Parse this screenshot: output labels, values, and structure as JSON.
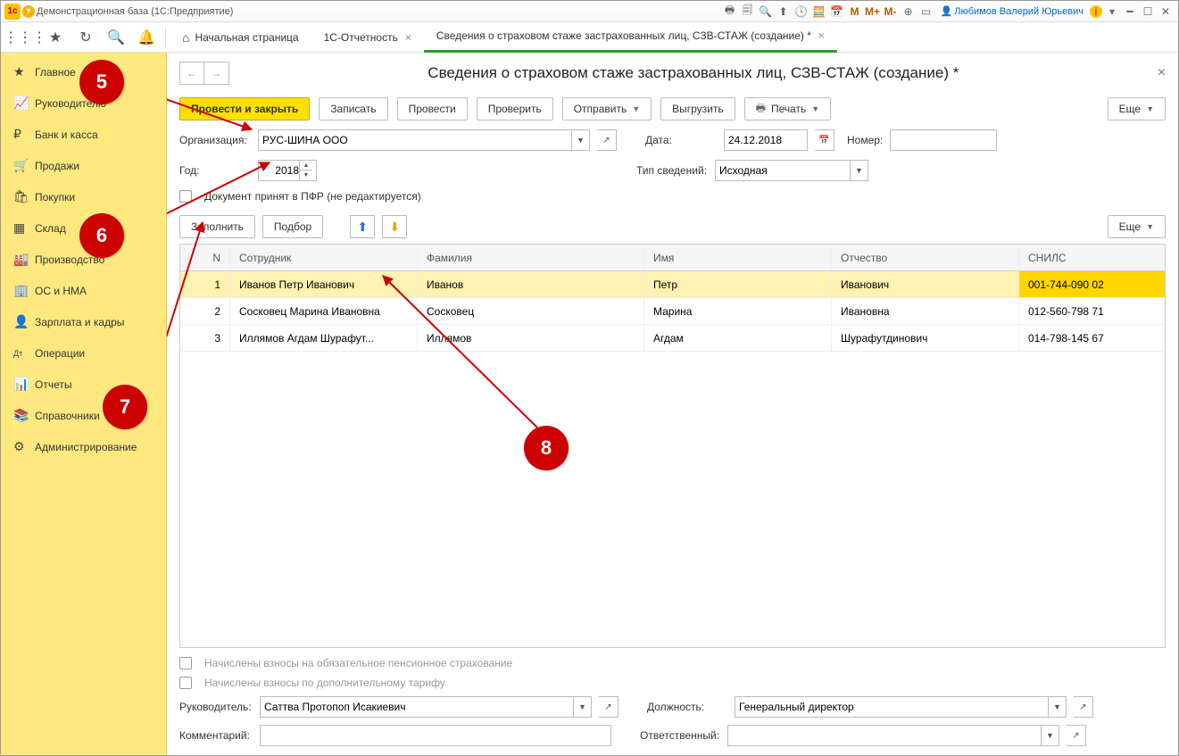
{
  "title": "Демонстрационная база  (1С:Предприятие)",
  "user": "Любимов Валерий Юрьевич",
  "toolbar_letters": {
    "m": "M",
    "mp": "M+",
    "mm": "M-"
  },
  "tabs": {
    "home": "Начальная страница",
    "t2": "1С-Отчетность",
    "t3": "Сведения о страховом стаже застрахованных лиц, СЗВ-СТАЖ (создание) *"
  },
  "sidebar": [
    {
      "icon": "★",
      "label": "Главное"
    },
    {
      "icon": "📈",
      "label": "Руководителю"
    },
    {
      "icon": "₽",
      "label": "Банк и касса"
    },
    {
      "icon": "🛒",
      "label": "Продажи"
    },
    {
      "icon": "🛍",
      "label": "Покупки"
    },
    {
      "icon": "▦",
      "label": "Склад"
    },
    {
      "icon": "🏭",
      "label": "Производство"
    },
    {
      "icon": "🏢",
      "label": "ОС и НМА"
    },
    {
      "icon": "👤",
      "label": "Зарплата и кадры"
    },
    {
      "icon": "Дт",
      "label": "Операции"
    },
    {
      "icon": "📊",
      "label": "Отчеты"
    },
    {
      "icon": "📚",
      "label": "Справочники"
    },
    {
      "icon": "⚙",
      "label": "Администрирование"
    }
  ],
  "header": "Сведения о страховом стаже застрахованных лиц, СЗВ-СТАЖ (создание) *",
  "buttons": {
    "post_close": "Провести и закрыть",
    "save": "Записать",
    "post": "Провести",
    "check": "Проверить",
    "send": "Отправить",
    "export": "Выгрузить",
    "print": "Печать",
    "more": "Еще"
  },
  "form": {
    "org_lbl": "Организация:",
    "org": "РУС-ШИНА ООО",
    "date_lbl": "Дата:",
    "date": "24.12.2018",
    "num_lbl": "Номер:",
    "year_lbl": "Год:",
    "year": "2018",
    "type_lbl": "Тип сведений:",
    "type": "Исходная",
    "pfr_lbl": "Документ принят в ПФР (не редактируется)"
  },
  "table_btns": {
    "fill": "Заполнить",
    "pick": "Подбор"
  },
  "cols": {
    "n": "N",
    "emp": "Сотрудник",
    "fam": "Фамилия",
    "im": "Имя",
    "ot": "Отчество",
    "sn": "СНИЛС"
  },
  "rows": [
    {
      "n": "1",
      "emp": "Иванов Петр Иванович",
      "fam": "Иванов",
      "im": "Петр",
      "ot": "Иванович",
      "sn": "001-744-090 02"
    },
    {
      "n": "2",
      "emp": "Сосковец Марина Ивановна",
      "fam": "Сосковец",
      "im": "Марина",
      "ot": "Ивановна",
      "sn": "012-560-798 71"
    },
    {
      "n": "3",
      "emp": "Иллямов Агдам Шурафут...",
      "fam": "Иллямов",
      "im": "Агдам",
      "ot": "Шурафутдинович",
      "sn": "014-798-145 67"
    }
  ],
  "bottom": {
    "chk1": "Начислены взносы на обязательное пенсионное страхование",
    "chk2": "Начислены взносы по дополнительному тарифу",
    "head_lbl": "Руководитель:",
    "head": "Саттва Протопоп Исакиевич",
    "pos_lbl": "Должность:",
    "pos": "Генеральный директор",
    "comm_lbl": "Комментарий:",
    "resp_lbl": "Ответственный:"
  },
  "badges": {
    "b5": "5",
    "b6": "6",
    "b7": "7",
    "b8": "8"
  }
}
